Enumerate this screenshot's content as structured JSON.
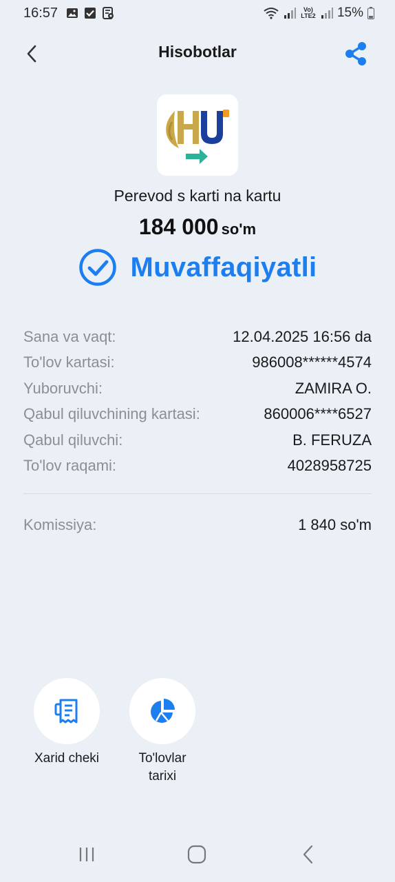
{
  "status_bar": {
    "time": "16:57",
    "network": "Vo) LTE2",
    "battery": "15%",
    "icons": [
      "image-icon",
      "check-box-icon",
      "settings-doc-icon",
      "wifi-icon",
      "signal-icon",
      "battery-icon"
    ]
  },
  "header": {
    "title": "Hisobotlar",
    "back_icon": "chevron-left-icon",
    "share_icon": "share-icon"
  },
  "transaction": {
    "service": "Perevod s karti na kartu",
    "amount": "184 000",
    "currency": "so'm",
    "status": "Muvaffaqiyatli",
    "status_color": "#1d7ef0"
  },
  "details": [
    {
      "label": "Sana va vaqt:",
      "value": "12.04.2025 16:56 da"
    },
    {
      "label": "To'lov kartasi:",
      "value": "986008******4574"
    },
    {
      "label": "Yuboruvchi:",
      "value": "ZAMIRA O."
    },
    {
      "label": "Qabul qiluvchining kartasi:",
      "value": "860006****6527"
    },
    {
      "label": "Qabul qiluvchi:",
      "value": "B. FERUZA"
    },
    {
      "label": "To'lov raqami:",
      "value": "4028958725"
    }
  ],
  "fee": {
    "label": "Komissiya:",
    "value": "1 840 so'm"
  },
  "actions": [
    {
      "label": "Xarid cheki",
      "icon": "receipt-icon"
    },
    {
      "label": "To'lovlar tarixi",
      "icon": "pie-chart-icon"
    }
  ],
  "colors": {
    "background": "#eaf0f6",
    "accent": "#1d7ef0",
    "logo_gold": "#c9a84c",
    "logo_blue": "#1b3f9b",
    "logo_teal": "#2bb39a",
    "logo_orange": "#f29b1d"
  }
}
